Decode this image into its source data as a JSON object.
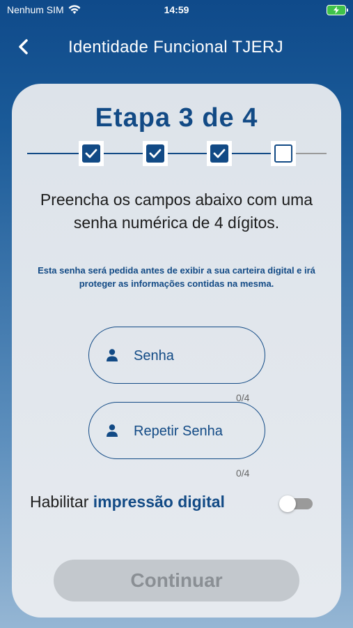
{
  "status_bar": {
    "carrier": "Nenhum SIM",
    "time": "14:59",
    "battery_color": "#3fc24a"
  },
  "header": {
    "title": "Identidade Funcional TJERJ"
  },
  "step": {
    "title": "Etapa 3 de 4",
    "total": 4,
    "completed": 3
  },
  "instructions": "Preencha os campos abaixo com uma senha numérica de 4 dígitos.",
  "note": "Esta senha será pedida antes de exibir a sua carteira digital e irá proteger as informações contidas na mesma.",
  "fields": {
    "password": {
      "placeholder": "Senha",
      "value": "",
      "counter": "0/4"
    },
    "repeat": {
      "placeholder": "Repetir Senha",
      "value": "",
      "counter": "0/4"
    }
  },
  "biometric": {
    "label_prefix": "Habilitar ",
    "label_emphasis": "impressão digital",
    "enabled": false
  },
  "continue_label": "Continuar",
  "colors": {
    "primary": "#124a85",
    "card": "#e3e8ee",
    "disabled_button": "#c3c8cd"
  }
}
